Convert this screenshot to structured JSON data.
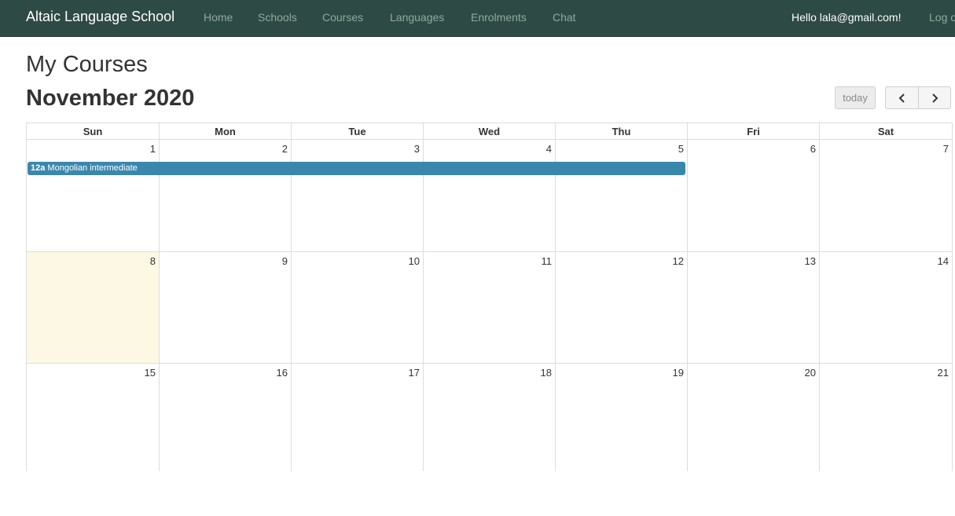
{
  "navbar": {
    "brand": "Altaic Language School",
    "links": [
      "Home",
      "Schools",
      "Courses",
      "Languages",
      "Enrolments",
      "Chat"
    ],
    "greeting": "Hello lala@gmail.com!",
    "logout": "Log o"
  },
  "page": {
    "title": "My Courses"
  },
  "calendar": {
    "title": "November 2020",
    "today_label": "today",
    "prev_icon": "‹",
    "next_icon": "›",
    "weekdays": [
      "Sun",
      "Mon",
      "Tue",
      "Wed",
      "Thu",
      "Fri",
      "Sat"
    ],
    "weeks": [
      [
        "1",
        "2",
        "3",
        "4",
        "5",
        "6",
        "7"
      ],
      [
        "8",
        "9",
        "10",
        "11",
        "12",
        "13",
        "14"
      ],
      [
        "15",
        "16",
        "17",
        "18",
        "19",
        "20",
        "21"
      ]
    ],
    "event": {
      "time": "12a",
      "title": "Mongolian intermediate"
    },
    "colors": {
      "event": "#3a87ad",
      "today_highlight": "#fcf8e3",
      "navbar": "#2e4a44"
    }
  }
}
